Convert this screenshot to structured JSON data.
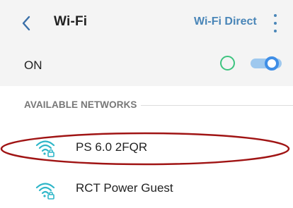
{
  "header": {
    "title": "Wi-Fi",
    "wifi_direct_label": "Wi-Fi Direct",
    "back_icon": "chevron-left-icon",
    "more_icon": "more-vert-icon"
  },
  "toggle_row": {
    "label": "ON",
    "enabled": true
  },
  "section": {
    "header": "AVAILABLE NETWORKS"
  },
  "networks": [
    {
      "name": "PS 6.0 2FQR",
      "secured": true,
      "icon": "wifi-lock-icon",
      "highlighted": true
    },
    {
      "name": "RCT Power Guest",
      "secured": true,
      "icon": "wifi-lock-icon",
      "highlighted": false
    }
  ],
  "colors": {
    "accent": "#4a86b8",
    "toggle_on": "#3f8ee6",
    "status_circle": "#3dc47f",
    "wifi_icon": "#2eb6c8",
    "highlight": "#a01414"
  }
}
